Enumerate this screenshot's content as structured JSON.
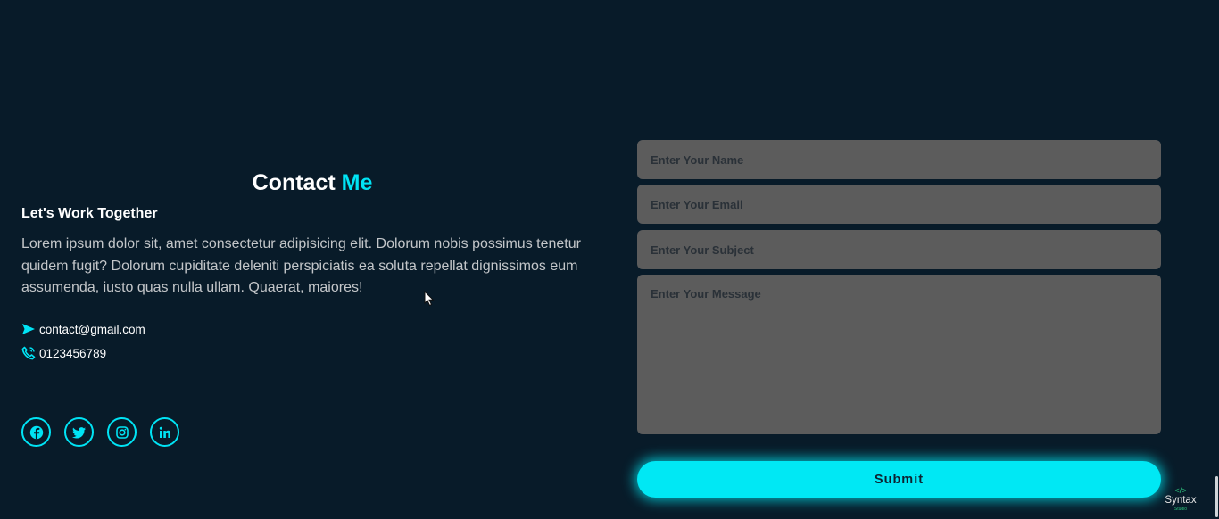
{
  "contact": {
    "title_main": "Contact",
    "title_accent": "Me",
    "subtitle": "Let's Work Together",
    "paragraph": "Lorem ipsum dolor sit, amet consectetur adipisicing elit. Dolorum nobis possimus tenetur quidem fugit? Dolorum cupiditate deleniti perspiciatis ea soluta repellat dignissimos eum assumenda, iusto quas nulla ullam. Quaerat, maiores!",
    "email": "contact@gmail.com",
    "phone": "0123456789",
    "socials": [
      "facebook-icon",
      "twitter-icon",
      "instagram-icon",
      "linkedin-icon"
    ]
  },
  "form": {
    "name_placeholder": "Enter Your Name",
    "email_placeholder": "Enter Your Email",
    "subject_placeholder": "Enter Your Subject",
    "message_placeholder": "Enter Your Message",
    "submit_label": "Submit"
  },
  "watermark": {
    "icon": "</>",
    "text": "Syntax",
    "sub": "Studio"
  },
  "colors": {
    "background": "#081b29",
    "accent": "#00e4f5",
    "field": "#5c5c5c"
  }
}
